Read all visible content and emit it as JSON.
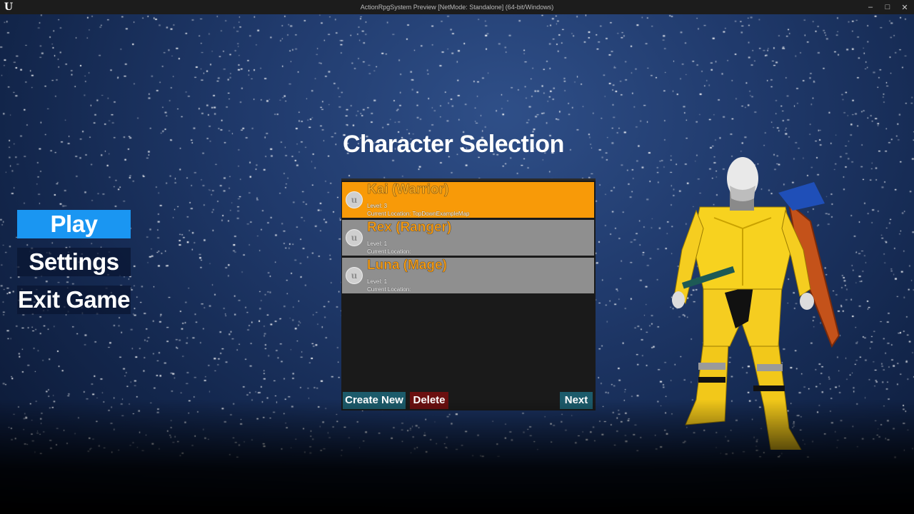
{
  "window": {
    "title": "ActionRpgSystem Preview [NetMode: Standalone]  (64-bit/Windows)",
    "logo": "U",
    "controls": [
      "–",
      "□",
      "✕"
    ]
  },
  "menu": {
    "items": [
      {
        "label": "Play",
        "active": true
      },
      {
        "label": "Settings",
        "active": false
      },
      {
        "label": "Exit Game",
        "active": false
      }
    ],
    "accent": "#1a96f2"
  },
  "selection": {
    "title": "Character Selection",
    "characters": [
      {
        "name": "Kai (Warrior)",
        "level": "Level: 3",
        "location": "Current Location: TopDownExampleMap",
        "selected": true
      },
      {
        "name": "Rex (Ranger)",
        "level": "Level: 1",
        "location": "Current Location:",
        "selected": false
      },
      {
        "name": "Luna (Mage)",
        "level": "Level: 1",
        "location": "Current Location:",
        "selected": false
      }
    ],
    "buttons": {
      "create_new": "Create New",
      "delete": "Delete",
      "next": "Next"
    },
    "colors": {
      "selected_row": "#f89a08",
      "row": "#8f8f8f",
      "create_new_bg": "#1c5b6b",
      "delete_bg": "#6b1010",
      "next_bg": "#1c5b6b"
    }
  }
}
